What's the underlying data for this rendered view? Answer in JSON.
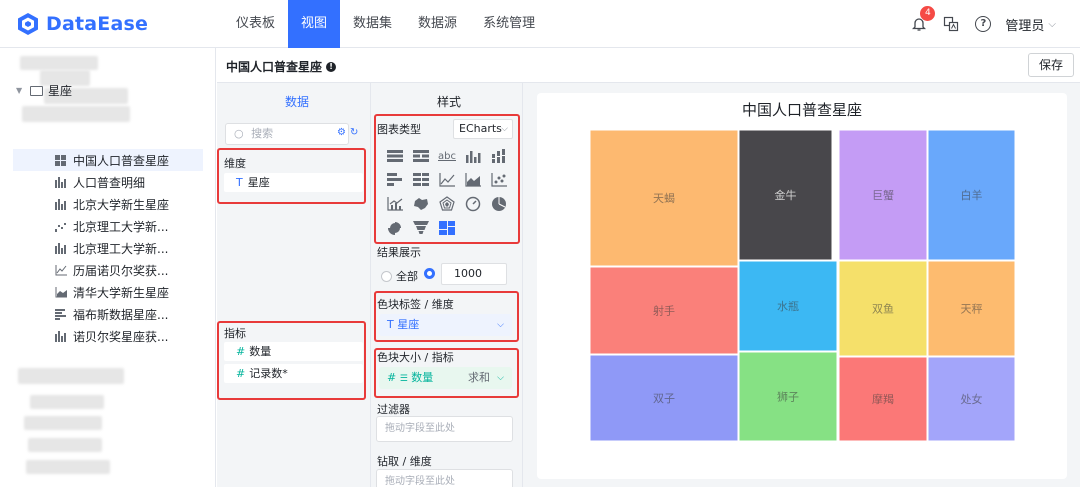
{
  "app": {
    "logo_text": "DataEase"
  },
  "nav": {
    "items": [
      "仪表板",
      "视图",
      "数据集",
      "数据源",
      "系统管理"
    ],
    "active_index": 1
  },
  "header_right": {
    "notification_count": "4",
    "help_glyph": "?",
    "user_name": "管理员"
  },
  "tree": {
    "folder_label": "星座",
    "items": [
      {
        "label": "中国人口普查星座",
        "icon": "treemap-icon",
        "active": true
      },
      {
        "label": "人口普查明细",
        "icon": "bar-chart-icon"
      },
      {
        "label": "北京大学新生星座",
        "icon": "bar-chart-icon"
      },
      {
        "label": "北京理工大学新...",
        "icon": "scatter-chart-icon"
      },
      {
        "label": "北京理工大学新...",
        "icon": "bar-chart-icon"
      },
      {
        "label": "历届诺贝尔奖获...",
        "icon": "line-chart-icon"
      },
      {
        "label": "清华大学新生星座",
        "icon": "area-chart-icon"
      },
      {
        "label": "福布斯数据星座...",
        "icon": "horizontal-bar-icon"
      },
      {
        "label": "诺贝尔奖星座获...",
        "icon": "bar-chart-icon"
      }
    ]
  },
  "titlebar": {
    "chart_name": "中国人口普查星座",
    "save_label": "保存"
  },
  "data_panel": {
    "tab_label": "数据",
    "search_placeholder": "搜索",
    "dimension_label": "维度",
    "dimension_prefix": "T",
    "dimension_fields": [
      "星座"
    ],
    "metric_label": "指标",
    "metric_prefix": "#",
    "metric_fields": [
      "数量",
      "记录数*"
    ]
  },
  "style_panel": {
    "tab_label": "样式",
    "chart_type_label": "图表类型",
    "chart_library": "ECharts",
    "chart_type_icons": [
      "table-info-icon",
      "table-normal-icon",
      "text-card-icon",
      "bar-icon",
      "stack-bar-icon",
      "horizontal-bar-icon",
      "horizontal-stack-bar-icon",
      "line-icon",
      "area-icon",
      "scatter-icon",
      "line-bar-icon",
      "map-icon",
      "radar-icon",
      "gauge-icon",
      "pie-icon",
      "rose-icon",
      "funnel-icon",
      "treemap-icon"
    ],
    "result_label": "结果展示",
    "result_all_label": "全部",
    "result_limit": "1000",
    "color_label": "色块标签 / 维度",
    "color_field_prefix": "T",
    "color_field": "星座",
    "size_label": "色块大小 / 指标",
    "size_field_prefix": "#",
    "size_field": "数量",
    "size_aggregation": "求和",
    "filter_label": "过滤器",
    "filter_placeholder": "拖动字段至此处",
    "drill_label": "钻取 / 维度",
    "drill_placeholder": "拖动字段至此处"
  },
  "chart_data": {
    "type": "treemap",
    "title": "中国人口普查星座",
    "colors": [
      "#fdb970",
      "#48474b",
      "#c49cf5",
      "#69a8fb",
      "#fa807a",
      "#3cb8f3",
      "#f5e06a",
      "#fdbb6f",
      "#8f99f7",
      "#86e184",
      "#fb7877",
      "#a3a5fa"
    ],
    "nodes": [
      {
        "name": "天蝎"
      },
      {
        "name": "金牛"
      },
      {
        "name": "巨蟹"
      },
      {
        "name": "白羊"
      },
      {
        "name": "射手"
      },
      {
        "name": "水瓶"
      },
      {
        "name": "双鱼"
      },
      {
        "name": "天秤"
      },
      {
        "name": "双子"
      },
      {
        "name": "狮子"
      },
      {
        "name": "摩羯"
      },
      {
        "name": "处女"
      }
    ]
  }
}
